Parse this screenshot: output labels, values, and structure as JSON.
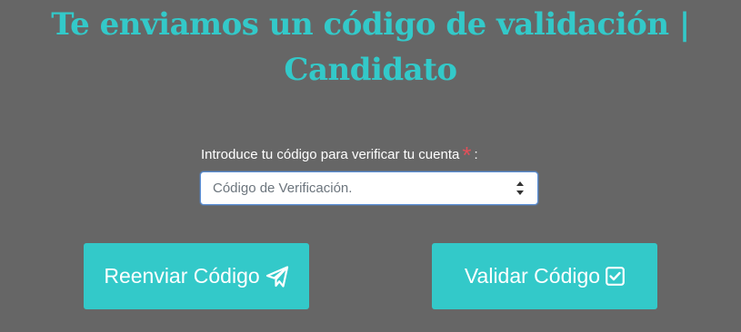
{
  "header": {
    "title_line1": "Te enviamos un código de validación |",
    "title_line2": "Candidato"
  },
  "form": {
    "label": "Introduce tu código para verificar tu cuenta",
    "required_mark": "*",
    "label_suffix": ":",
    "code_input": {
      "placeholder": "Código de Verificación.",
      "value": ""
    }
  },
  "actions": {
    "resend_label": "Reenviar Código",
    "resend_icon": "paper-plane-icon",
    "validate_label": "Validar Código",
    "validate_icon": "check-square-icon"
  },
  "colors": {
    "background": "#666666",
    "accent": "#33c9c9",
    "required": "#e0505a",
    "input_focus": "#5a8fd6"
  }
}
